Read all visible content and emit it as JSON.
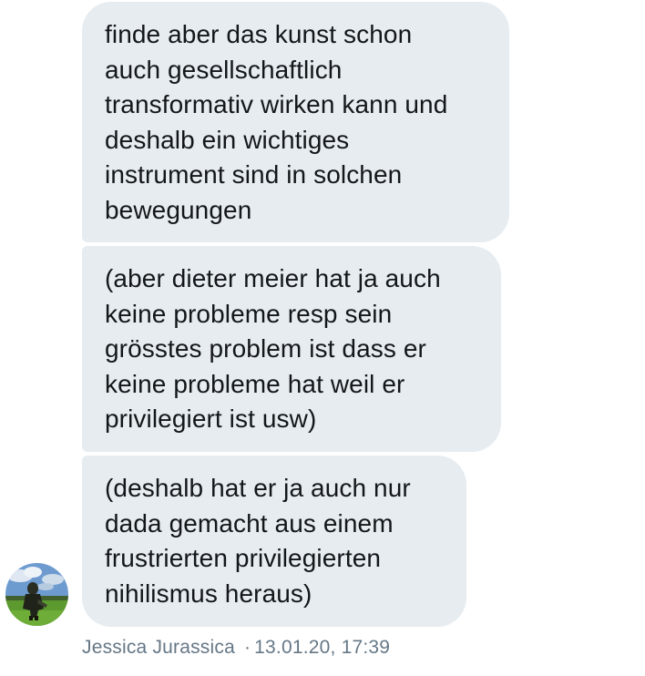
{
  "messages": [
    {
      "text": "finde aber das kunst schon\nauch gesellschaftlich\ntransformativ wirken kann und\ndeshalb ein wichtiges\ninstrument sind in solchen\nbewegungen"
    },
    {
      "text": "(aber dieter meier hat ja auch\nkeine probleme resp sein\ngrösstes problem ist dass er\nkeine probleme hat weil er\nprivilegiert ist usw)"
    },
    {
      "text": "(deshalb hat er ja auch nur\ndada gemacht aus einem\nfrustrierten privilegierten\nnihilismus heraus)"
    }
  ],
  "sender": {
    "name": "Jessica Jurassica",
    "separator": "·",
    "timestamp": "13.01.20, 17:39"
  },
  "colors": {
    "bubble": "#e6ecf0",
    "text": "#14171a",
    "meta": "#657786"
  },
  "icons": {
    "avatar": "profile-avatar-image"
  }
}
